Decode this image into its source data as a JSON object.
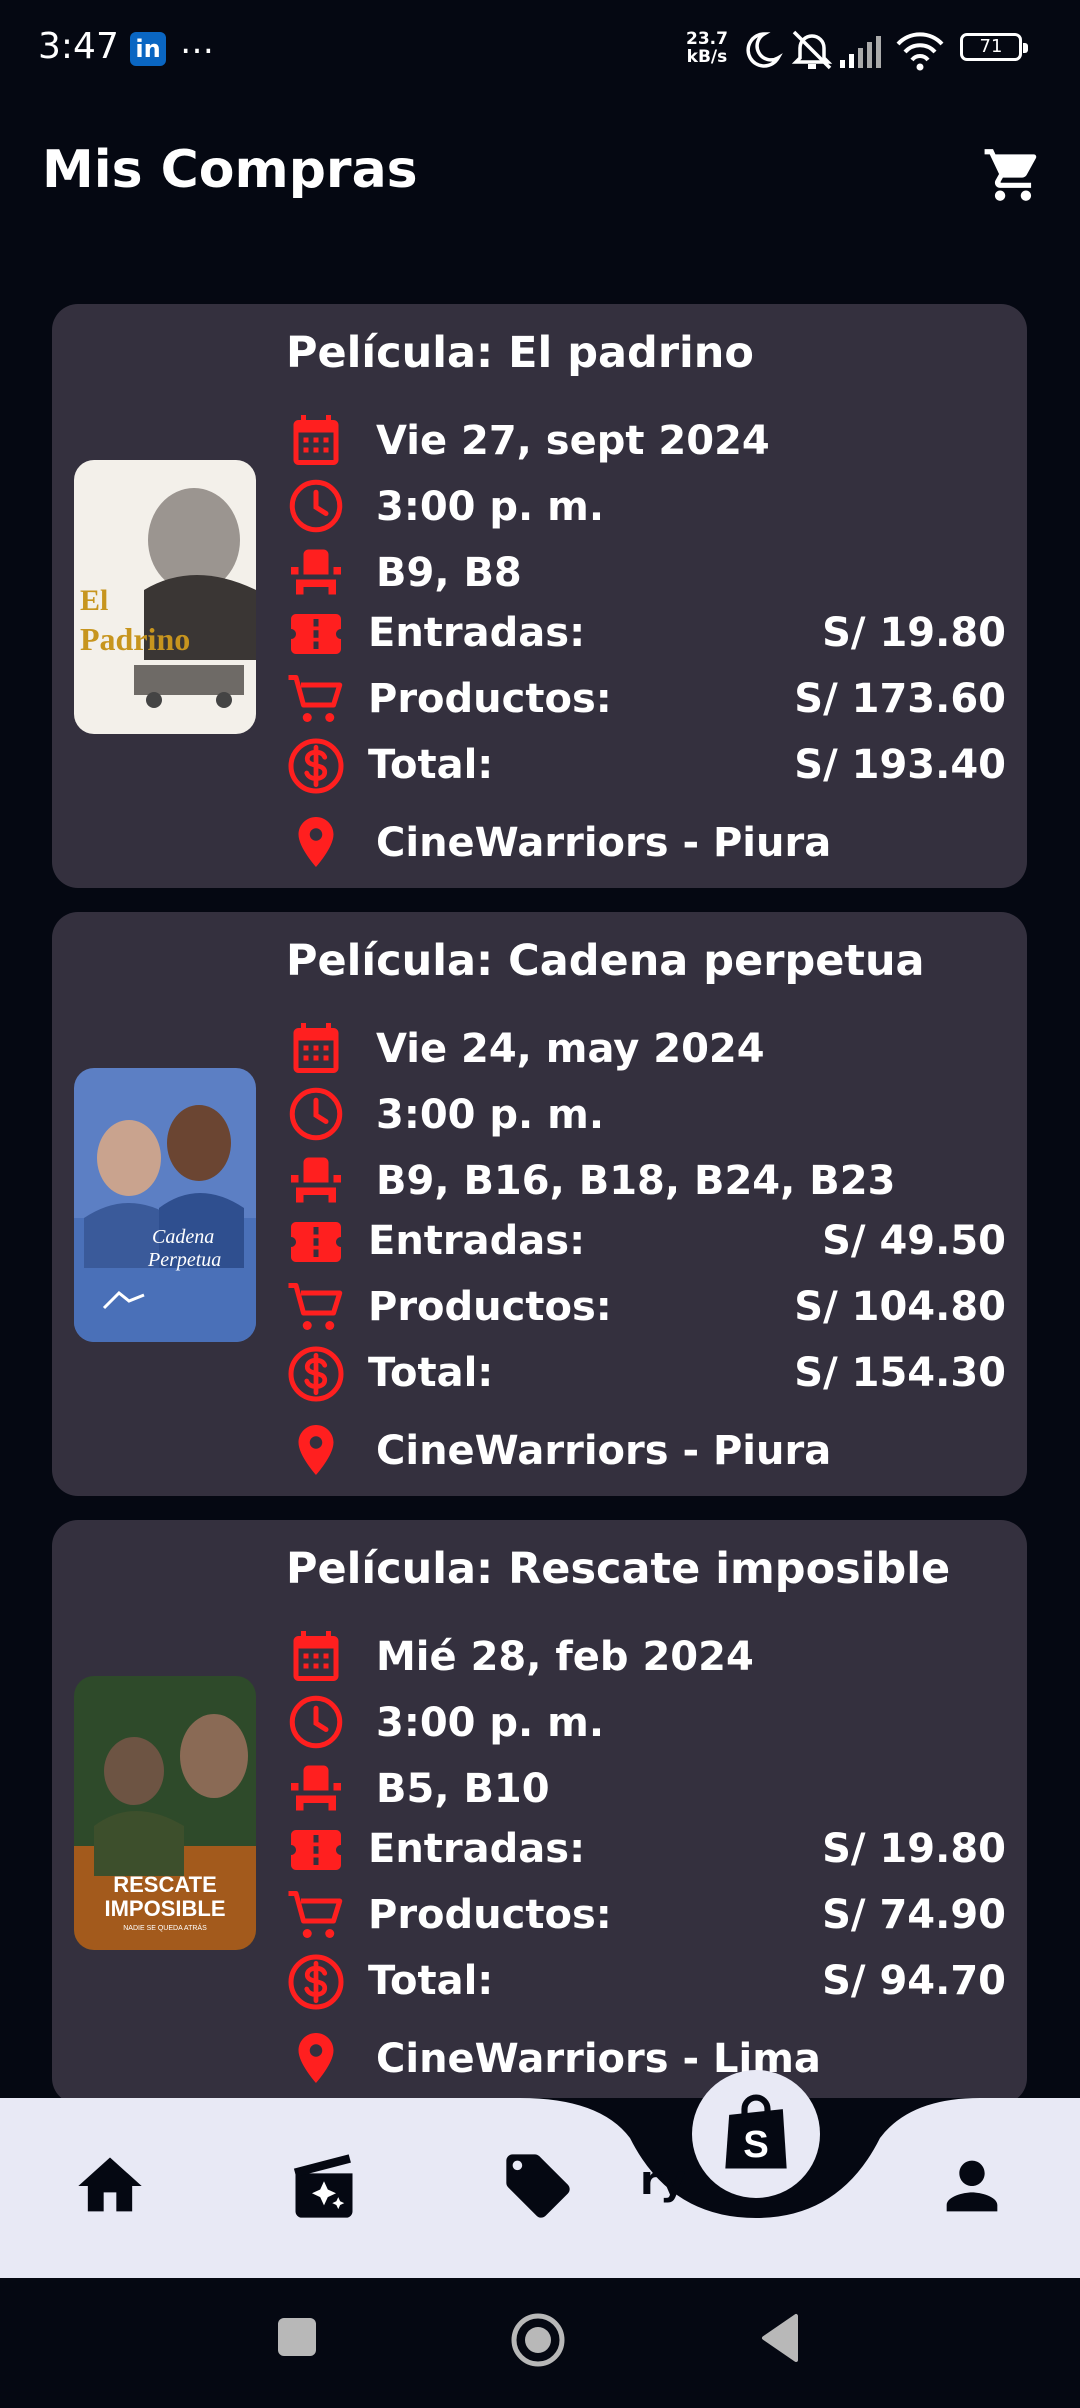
{
  "status_bar": {
    "time": "3:47",
    "linkedin": "in",
    "more": "…",
    "speed": "23.7",
    "speed_unit": "kB/s",
    "battery": "71"
  },
  "header": {
    "title": "Mis Compras"
  },
  "poster_texts": [
    "El Padrino",
    "Cadena Perpetua",
    "RESCATE IMPOSIBLE",
    "NADIE SE QUEDA ATRÁS"
  ],
  "purchases": [
    {
      "title": "Película: El padrino",
      "date": "Vie 27, sept 2024",
      "time": "3:00 p. m.",
      "seats": "B9, B8",
      "tickets_label": "Entradas:",
      "tickets_value": "S/ 19.80",
      "products_label": "Productos:",
      "products_value": "S/ 173.60",
      "total_label": "Total:",
      "total_value": "S/ 193.40",
      "location": "CineWarriors - Piura"
    },
    {
      "title": "Película: Cadena perpetua",
      "date": "Vie 24, may 2024",
      "time": "3:00 p. m.",
      "seats": "B9, B16, B18, B24, B23",
      "tickets_label": "Entradas:",
      "tickets_value": "S/ 49.50",
      "products_label": "Productos:",
      "products_value": "S/ 104.80",
      "total_label": "Total:",
      "total_value": "S/ 154.30",
      "location": "CineWarriors - Piura"
    },
    {
      "title": "Película: Rescate imposible",
      "date": "Mié 28, feb 2024",
      "time": "3:00 p. m.",
      "seats": "B5, B10",
      "tickets_label": "Entradas:",
      "tickets_value": "S/ 19.80",
      "products_label": "Productos:",
      "products_value": "S/ 74.90",
      "total_label": "Total:",
      "total_value": "S/ 94.70",
      "location": "CineWarriors - Lima"
    }
  ],
  "bottom_nav": {
    "partial_label": "ry",
    "items": [
      "home-icon",
      "movies-icon",
      "tag-icon",
      "shop-icon",
      "profile-icon"
    ]
  },
  "colors": {
    "accent": "#ff1f1f",
    "card": "#34303e",
    "background": "#050812",
    "nav": "#e8e9f5"
  }
}
